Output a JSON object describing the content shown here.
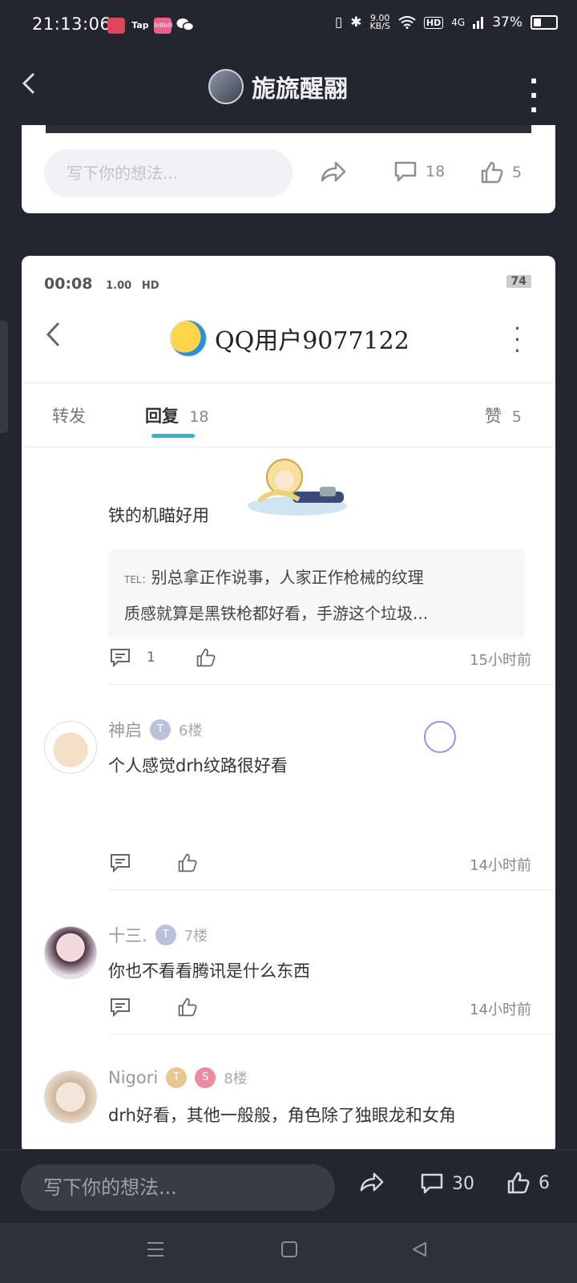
{
  "status_bar": {
    "time": "21:13:06",
    "app_badge_1": "",
    "app_badge_2": "Tap",
    "app_badge_3": "bilibili",
    "net_speed": "9.00",
    "net_unit": "KB/S",
    "hd": "HD",
    "network": "4G",
    "battery": "37%"
  },
  "header": {
    "title": "旎旒醒翮"
  },
  "card1": {
    "input_placeholder": "写下你的想法...",
    "comments": "18",
    "likes": "5"
  },
  "inner": {
    "status": {
      "time": "00:08",
      "net_speed": "1.00",
      "net_unit": "KB/S",
      "hd": "HD",
      "battery": "74"
    },
    "title": "QQ用户9077122",
    "tabs": [
      {
        "label": "转发"
      },
      {
        "label": "回复",
        "count": "18"
      },
      {
        "label": "赞",
        "count": "5"
      }
    ],
    "top_reply": {
      "text": "铁的机瞄好用",
      "quote_prefix": "TEL：",
      "quote_line1": "别总拿正作说事，人家正作枪械的纹理",
      "quote_line2": "质感就算是黑铁枪都好看，手游这个垃圾...",
      "reply_count": "1",
      "ago": "15小时前"
    },
    "comments": [
      {
        "name": "神启",
        "badge": "T",
        "floor": "6楼",
        "text": "个人感觉drh纹路很好看",
        "ago": "14小时前"
      },
      {
        "name": "十三.",
        "badge": "T",
        "floor": "7楼",
        "text": "你也不看看腾讯是什么东西",
        "ago": "14小时前"
      },
      {
        "name": "Nigori",
        "badge": "T",
        "badge2": "S",
        "floor": "8楼",
        "text": "drh好看，其他一般般，角色除了独眼龙和女角"
      }
    ]
  },
  "bottom": {
    "input_placeholder": "写下你的想法...",
    "comments": "30",
    "likes": "6"
  },
  "colors": {
    "background": "#23262f",
    "accent": "#2fb7c5",
    "card": "#ffffff"
  }
}
